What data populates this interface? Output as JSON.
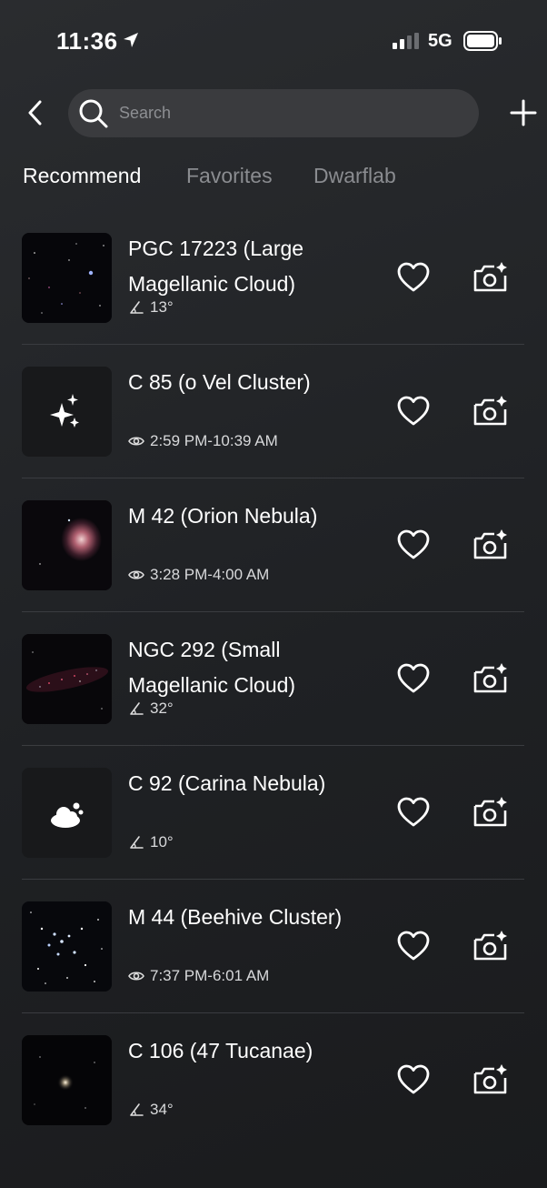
{
  "status": {
    "time": "11:36",
    "network": "5G"
  },
  "search": {
    "placeholder": "Search"
  },
  "tabs": [
    {
      "label": "Recommend",
      "active": true
    },
    {
      "label": "Favorites",
      "active": false
    },
    {
      "label": "Dwarflab",
      "active": false
    }
  ],
  "items": [
    {
      "name": "PGC 17223 (Large Magellanic Cloud)",
      "meta_icon": "angle-icon",
      "meta": "13°",
      "thumb": "lmc-photo"
    },
    {
      "name": "C 85 (o Vel Cluster)",
      "meta_icon": "eye-icon",
      "meta": "2:59 PM-10:39 AM",
      "thumb": "sparkles-icon"
    },
    {
      "name": "M 42 (Orion Nebula)",
      "meta_icon": "eye-icon",
      "meta": "3:28 PM-4:00 AM",
      "thumb": "orion-photo"
    },
    {
      "name": "NGC 292 (Small Magellanic Cloud)",
      "meta_icon": "angle-icon",
      "meta": "32°",
      "thumb": "smc-photo"
    },
    {
      "name": "C 92 (Carina Nebula)",
      "meta_icon": "angle-icon",
      "meta": "10°",
      "thumb": "cloud-icon"
    },
    {
      "name": "M 44 (Beehive Cluster)",
      "meta_icon": "eye-icon",
      "meta": "7:37 PM-6:01 AM",
      "thumb": "beehive-photo"
    },
    {
      "name": "C 106 (47 Tucanae)",
      "meta_icon": "angle-icon",
      "meta": "34°",
      "thumb": "tucanae-photo"
    }
  ],
  "colors": {
    "background": "#1f2124",
    "search_bg": "#3a3b3e",
    "inactive_tab": "#8a8c90",
    "divider": "#3a3c40"
  }
}
